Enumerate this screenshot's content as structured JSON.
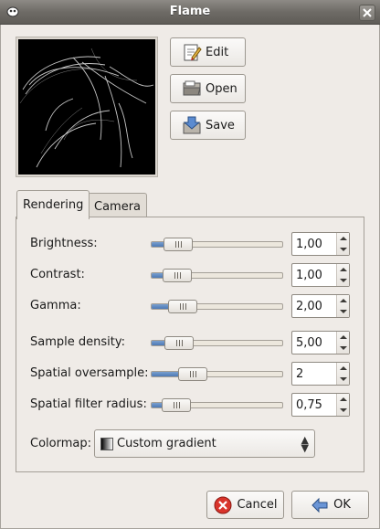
{
  "window": {
    "title": "Flame"
  },
  "actions": {
    "edit_label": "Edit",
    "open_label": "Open",
    "save_label": "Save"
  },
  "tabs": [
    {
      "label": "Rendering",
      "active": true
    },
    {
      "label": "Camera",
      "active": false
    }
  ],
  "settings": [
    {
      "label": "Brightness:",
      "value": "1,00",
      "level": 0.12
    },
    {
      "label": "Contrast:",
      "value": "1,00",
      "level": 0.11
    },
    {
      "label": "Gamma:",
      "value": "2,00",
      "level": 0.16
    },
    {
      "label": "Sample density:",
      "value": "5,00",
      "level": 0.13
    },
    {
      "label": "Spatial oversample:",
      "value": "2",
      "level": 0.26
    },
    {
      "label": "Spatial filter radius:",
      "value": "0,75",
      "level": 0.1
    }
  ],
  "colormap": {
    "label": "Colormap:",
    "selected": "Custom gradient"
  },
  "footer": {
    "cancel_label": "Cancel",
    "ok_label": "OK"
  },
  "colors": {
    "slider_fill": "#4d79b5",
    "preview_bg": "#000000"
  }
}
